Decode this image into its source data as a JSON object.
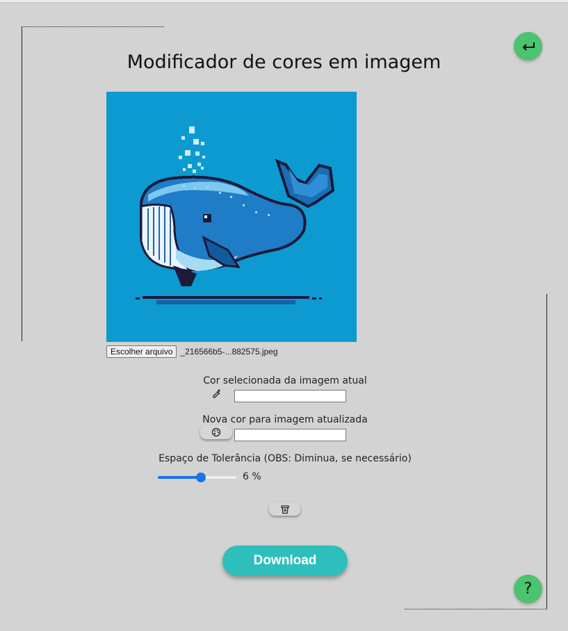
{
  "page": {
    "title": "Modificador de cores em imagem"
  },
  "nav": {
    "back_icon": "return-arrow-icon",
    "back_glyph": "↩",
    "help_label": "?"
  },
  "image": {
    "description_icon": "whale-pixel-art-image"
  },
  "file_input": {
    "button_label": "Escolher arquivo",
    "file_name": "_216566b5-...882575.jpeg"
  },
  "current_color": {
    "label": "Cor selecionada da imagem atual",
    "icon": "eyedropper-icon",
    "value": ""
  },
  "new_color": {
    "label": "Nova cor para imagem atualizada",
    "icon": "palette-icon",
    "value": ""
  },
  "tolerance": {
    "label": "Espaço de Tolerância (OBS: Diminua, se necessário)",
    "value_text": "6 %",
    "value": 6,
    "fraction": 0.55
  },
  "actions": {
    "trash_icon": "trash-icon",
    "download_label": "Download"
  },
  "colors": {
    "background": "#d3d3d3",
    "green_button": "#4cc36e",
    "download_button": "#2ebfbd",
    "slider_accent": "#1a73e8",
    "whale_background": "#0c9ad1"
  }
}
